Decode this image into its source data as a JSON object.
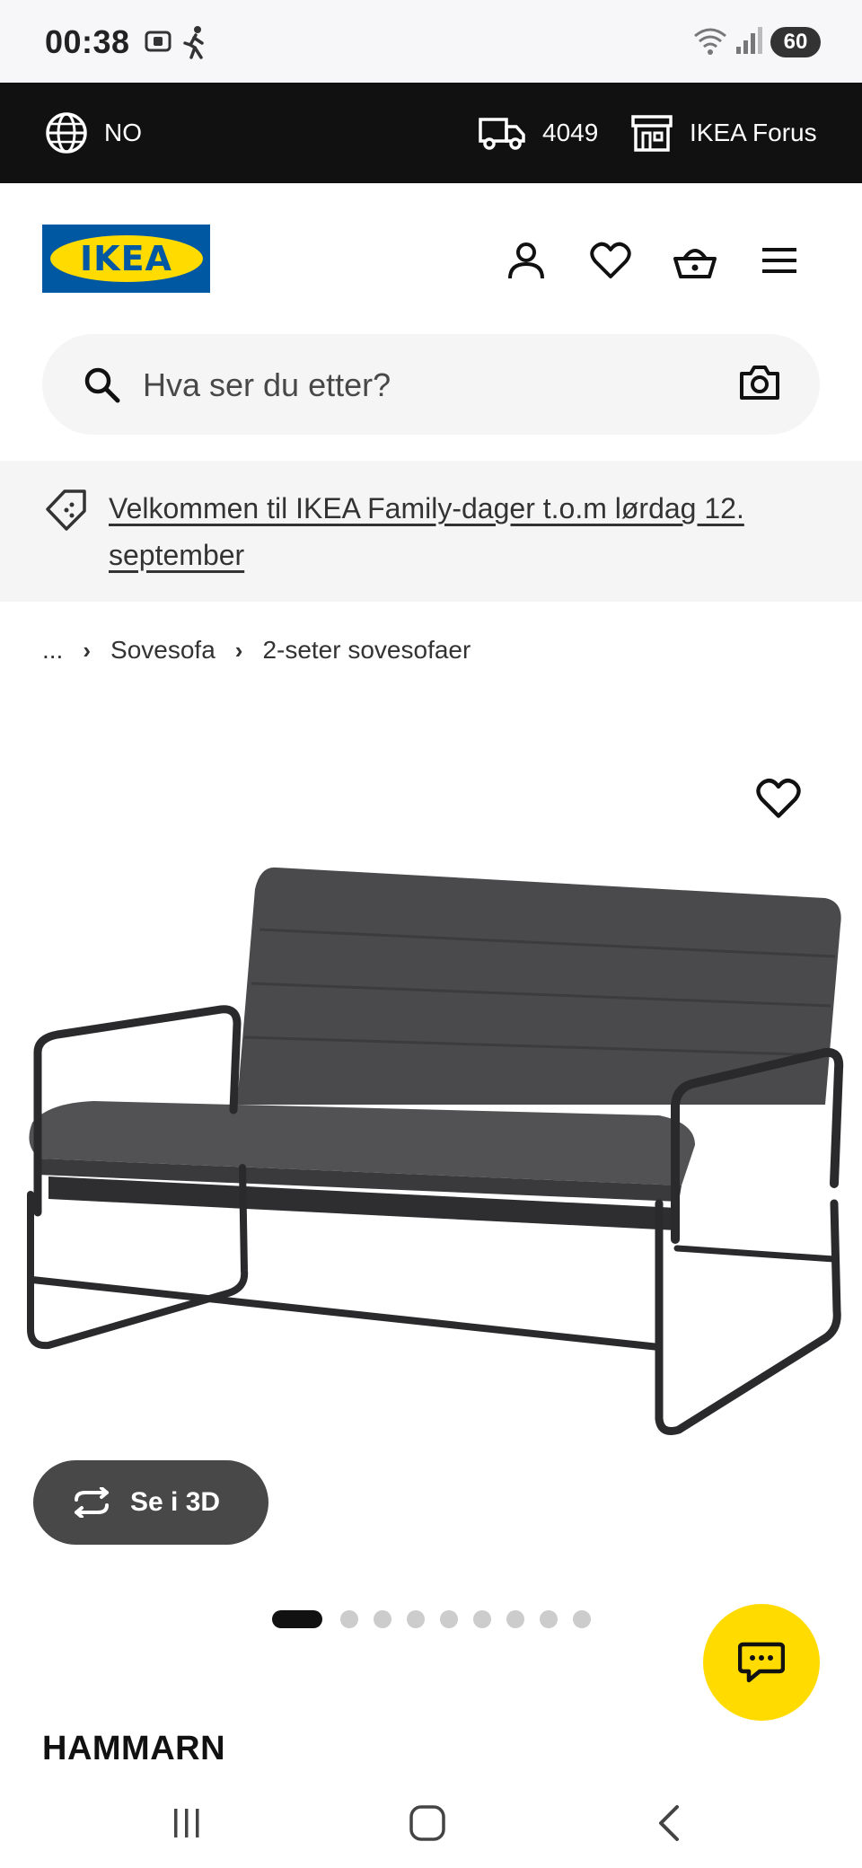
{
  "status_bar": {
    "time": "00:38",
    "battery": "60",
    "icons": [
      "screenshot-icon",
      "walking-icon",
      "wifi-icon",
      "signal-icon"
    ]
  },
  "top_bar": {
    "language": "NO",
    "postcode": "4049",
    "store": "IKEA Forus"
  },
  "header": {
    "logo_text": "IKEA",
    "icons": [
      "profile-icon",
      "heart-icon",
      "basket-icon",
      "menu-icon"
    ]
  },
  "search": {
    "placeholder": "Hva ser du etter?"
  },
  "promo": {
    "text": "Velkommen til IKEA Family-dager t.o.m lørdag 12. september"
  },
  "breadcrumb": {
    "items": [
      "...",
      "Sovesofa",
      "2-seter sovesofaer"
    ]
  },
  "gallery": {
    "view_3d_label": "Se i 3D",
    "dot_count": 9,
    "active_dot": 0
  },
  "product": {
    "name": "HAMMARN"
  },
  "colors": {
    "ikea_blue": "#0058a3",
    "ikea_yellow": "#ffdb00",
    "top_bar_bg": "#111111",
    "button_3d_bg": "#484848"
  }
}
